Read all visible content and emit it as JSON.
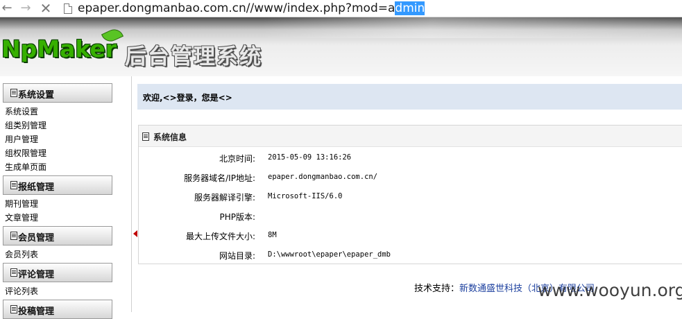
{
  "browser": {
    "url_prefix": "epaper.dongmanbao.com.cn//www/index.php?mod=a",
    "url_selected": "dmin"
  },
  "header": {
    "logo_text": "NpMaker",
    "title": "后台管理系统"
  },
  "sidebar": {
    "groups": [
      {
        "label": "系统设置",
        "items": [
          "系统设置",
          "组类别管理",
          "用户管理",
          "组权限管理",
          "生成单页面"
        ]
      },
      {
        "label": "报纸管理",
        "items": [
          "期刊管理",
          "文章管理"
        ]
      },
      {
        "label": "会员管理",
        "items": [
          "会员列表"
        ]
      },
      {
        "label": "评论管理",
        "items": [
          "评论列表"
        ]
      },
      {
        "label": "投稿管理",
        "items": []
      }
    ]
  },
  "main": {
    "welcome": "欢迎,<>登录，您是<>",
    "sysinfo_title": "系统信息",
    "rows": [
      {
        "label": "北京时间:",
        "value": "2015-05-09 13:16:26"
      },
      {
        "label": "服务器域名/IP地址:",
        "value": "epaper.dongmanbao.com.cn/"
      },
      {
        "label": "服务器解译引擎:",
        "value": "Microsoft-IIS/6.0"
      },
      {
        "label": "PHP版本:",
        "value": ""
      },
      {
        "label": "最大上传文件大小:",
        "value": "8M"
      },
      {
        "label": "网站目录:",
        "value": "D:\\wwwroot\\epaper\\epaper_dmb"
      }
    ],
    "support_label": "技术支持：",
    "support_link": "新数通盛世科技（北京）有限公司"
  },
  "watermark": "www.wooyun.org",
  "colors": {
    "welcome_bg": "#dde6f2",
    "logo_green": "#36b000",
    "link_blue": "#1b3f9e",
    "selection": "#3399ff"
  }
}
